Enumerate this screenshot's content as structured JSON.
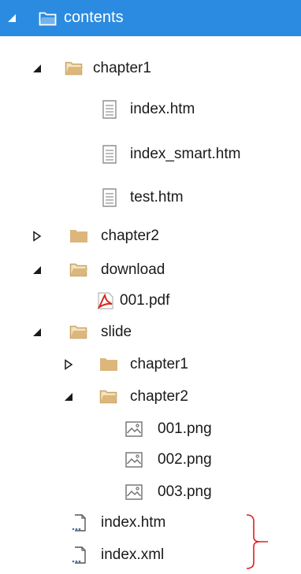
{
  "tree": {
    "root": {
      "label": "contents",
      "expanded": true,
      "selected": true
    },
    "items": [
      {
        "label": "chapter1",
        "kind": "folder",
        "expanded": true
      },
      {
        "label": "index.htm",
        "kind": "file"
      },
      {
        "label": "index_smart.htm",
        "kind": "file"
      },
      {
        "label": "test.htm",
        "kind": "file"
      },
      {
        "label": "chapter2",
        "kind": "folder",
        "expanded": false
      },
      {
        "label": "download",
        "kind": "folder",
        "expanded": true
      },
      {
        "label": "001.pdf",
        "kind": "pdf"
      },
      {
        "label": "slide",
        "kind": "folder",
        "expanded": true
      },
      {
        "label": "chapter1",
        "kind": "folder",
        "expanded": false
      },
      {
        "label": "chapter2",
        "kind": "folder",
        "expanded": true
      },
      {
        "label": "001.png",
        "kind": "image"
      },
      {
        "label": "002.png",
        "kind": "image"
      },
      {
        "label": "003.png",
        "kind": "image"
      },
      {
        "label": "index.htm",
        "kind": "web"
      },
      {
        "label": "index.xml",
        "kind": "web"
      }
    ]
  },
  "colors": {
    "selection": "#2b8be0",
    "folder": "#dcb67a",
    "annotation": "#e02020",
    "pdf": "#d8261c"
  },
  "icons": {
    "expanded": "triangle-down-right-icon",
    "collapsed": "triangle-right-outline-icon",
    "folder_open": "folder-open-icon",
    "folder_closed": "folder-closed-icon",
    "file": "document-icon",
    "pdf": "pdf-icon",
    "image": "image-icon",
    "web": "web-document-icon"
  }
}
